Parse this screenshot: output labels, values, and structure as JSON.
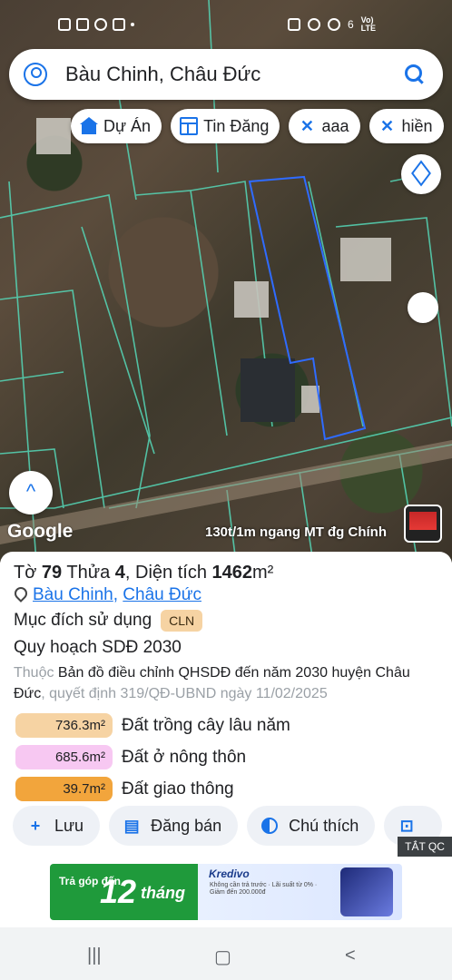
{
  "status": {
    "net_top": "Vo)",
    "net_bottom": "LTE",
    "signal": "6"
  },
  "search": {
    "query": "Bàu Chinh, Châu Đức"
  },
  "chips": [
    {
      "label": "Dự Án",
      "icon": "building-icon"
    },
    {
      "label": "Tin Đăng",
      "icon": "list-icon"
    },
    {
      "label": "aaa",
      "icon": "ruler-icon"
    },
    {
      "label": "hiền",
      "icon": "ruler-icon"
    }
  ],
  "map": {
    "brand": "Google",
    "ad_label": "130t/1m ngang MT đg Chính"
  },
  "parcel": {
    "to_label": "Tờ",
    "to_value": "79",
    "thua_label": "Thửa",
    "thua_value": "4",
    "area_label": ", Diện tích",
    "area_value": "1462",
    "area_unit": "m²",
    "location_a": "Bàu Chinh",
    "location_b": "Châu Đức",
    "usage_label": "Mục đích sử dụng",
    "usage_code": "CLN",
    "plan_label": "Quy hoạch SDĐ 2030",
    "desc_prefix": "Thuộc",
    "desc_main": "Bản đồ điều chỉnh QHSDĐ đến năm 2030 huyện Châu Đức",
    "desc_suffix": ", quyết định 319/QĐ-UBND ngày 11/02/2025",
    "zones": [
      {
        "area": "736.3m²",
        "label": "Đất trồng cây lâu năm",
        "color": "#f6d3a3"
      },
      {
        "area": "685.6m²",
        "label": "Đất ở nông thôn",
        "color": "#f7c8f2"
      },
      {
        "area": "39.7m²",
        "label": "Đất giao thông",
        "color": "#f2a53c"
      }
    ]
  },
  "actions": [
    {
      "label": "Lưu",
      "icon": "bookmark-plus-icon"
    },
    {
      "label": "Đăng bán",
      "icon": "calendar-icon"
    },
    {
      "label": "Chú thích",
      "icon": "contrast-icon"
    }
  ],
  "ad": {
    "close_label": "TẮT QC",
    "line1": "Trả góp đến",
    "big": "12",
    "word": "tháng",
    "brand": "Kredivo",
    "fine": "Không cần trả trước · Lãi suất từ 0% · Giảm đến 200.000đ"
  }
}
